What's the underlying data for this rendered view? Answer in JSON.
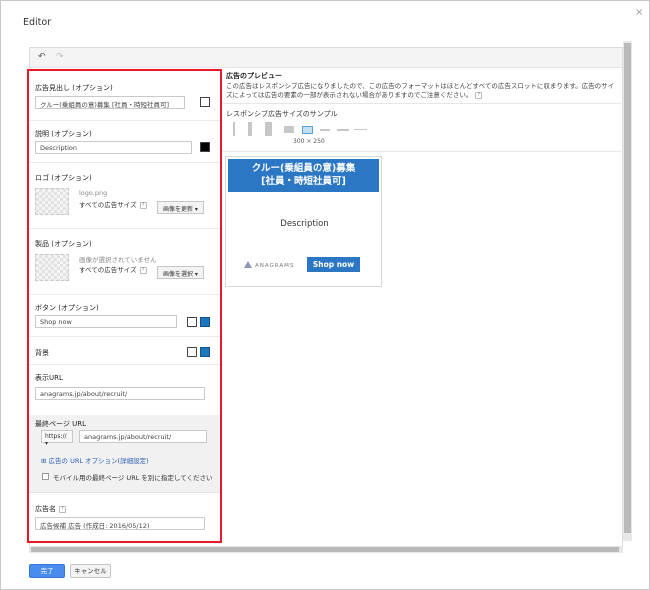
{
  "window": {
    "title": "Editor",
    "close_label": "×"
  },
  "toolbar": {
    "undo_glyph": "↶",
    "redo_glyph": "↷"
  },
  "form": {
    "headline": {
      "label": "広告見出し (オプション)",
      "value": "クルー(乗組員の意)募集 [社員・時短社員可]"
    },
    "description": {
      "label": "説明 (オプション)",
      "value": "Description"
    },
    "logo": {
      "label": "ロゴ (オプション)",
      "filename": "logo.png",
      "size_text": "すべての広告サイズ",
      "button": "画像を更新 ▾"
    },
    "product": {
      "label": "製品 (オプション)",
      "status": "画像が選択されていません",
      "size_text": "すべての広告サイズ",
      "button": "画像を選択 ▾"
    },
    "button_text": {
      "label": "ボタン (オプション)",
      "value": "Shop now"
    },
    "background": {
      "label": "背景"
    },
    "display_url": {
      "label": "表示URL",
      "value": "anagrams.jp/about/recruit/"
    },
    "final_url": {
      "label": "最終ページ URL",
      "protocol": "https:// ▾",
      "value": "anagrams.jp/about/recruit/",
      "options_link": "⊞ 広告の URL オプション(詳細設定)",
      "mobile_check": "モバイル用の最終ページ URL を別に指定してください"
    },
    "ad_name": {
      "label": "広告名",
      "value": "広告候補 広告 (作成日: 2016/05/12)"
    },
    "help_glyph": "?"
  },
  "preview": {
    "title": "広告のプレビュー",
    "description": "この広告はレスポンシブ広告になりましたので、この広告のフォーマットはほとんどすべての広告スロットに収まります。広告のサイズによっては広告の要素の一部が表示されない場合がありますのでご注意ください。",
    "sample_label": "レスポンシブ広告サイズのサンプル",
    "selected_size": "300 × 250",
    "ad": {
      "headline_line1": "クルー(乗組員の意)募集",
      "headline_line2": "[社員・時短社員可]",
      "description": "Description",
      "logo_text": "ANAGRAMS",
      "button": "Shop now"
    }
  },
  "actions": {
    "done": "完了",
    "cancel": "キャンセル"
  },
  "colors": {
    "ad_blue": "#2b77c4",
    "highlight_red": "#e8182a",
    "primary_button": "#4a8bee",
    "link": "#2a5db0"
  }
}
